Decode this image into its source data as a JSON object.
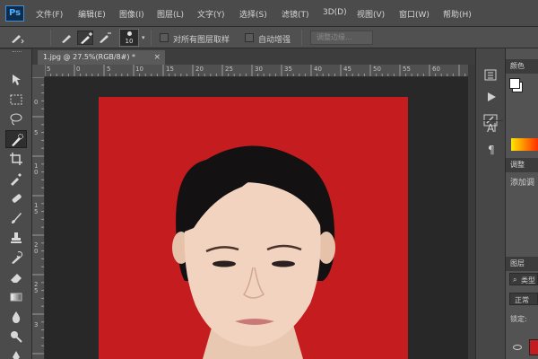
{
  "app": {
    "logo": "Ps"
  },
  "menu": [
    "文件(F)",
    "编辑(E)",
    "图像(I)",
    "图层(L)",
    "文字(Y)",
    "选择(S)",
    "滤镜(T)",
    "3D(D)",
    "视图(V)",
    "窗口(W)",
    "帮助(H)"
  ],
  "options": {
    "brush_size": "10",
    "sample_all_layers": "对所有图层取样",
    "auto_enhance": "自动增强",
    "refine_edge": "调整边缘..."
  },
  "document": {
    "tab_title": "1.jpg @ 27.5%(RGB/8#) *",
    "close_glyph": "×"
  },
  "rulers": {
    "horizontal": [
      "5",
      "0",
      "5",
      "10",
      "15",
      "20",
      "25",
      "30",
      "35",
      "40",
      "45",
      "50",
      "55",
      "60"
    ],
    "vertical": [
      "0",
      "5",
      "1 0",
      "1 5",
      "2 0",
      "2 5",
      "3"
    ]
  },
  "panels": {
    "color_tab": "颜色",
    "adjustments_tab": "调整",
    "adjustments_add": "添加调",
    "layers_tab": "图层",
    "layers_kind": "类型",
    "blend_mode": "正常",
    "lock": "锁定:"
  },
  "tools": [
    "move-tool",
    "marquee-tool",
    "lasso-tool",
    "quick-selection-tool",
    "crop-tool",
    "eyedropper-tool",
    "spot-healing-tool",
    "brush-tool",
    "clone-stamp-tool",
    "history-brush-tool",
    "eraser-tool",
    "gradient-tool",
    "blur-tool",
    "dodge-tool",
    "pen-tool"
  ],
  "colors": {
    "photo_background": "#c41c1f",
    "menubar": "#4b4b4b",
    "canvas": "#282828"
  }
}
